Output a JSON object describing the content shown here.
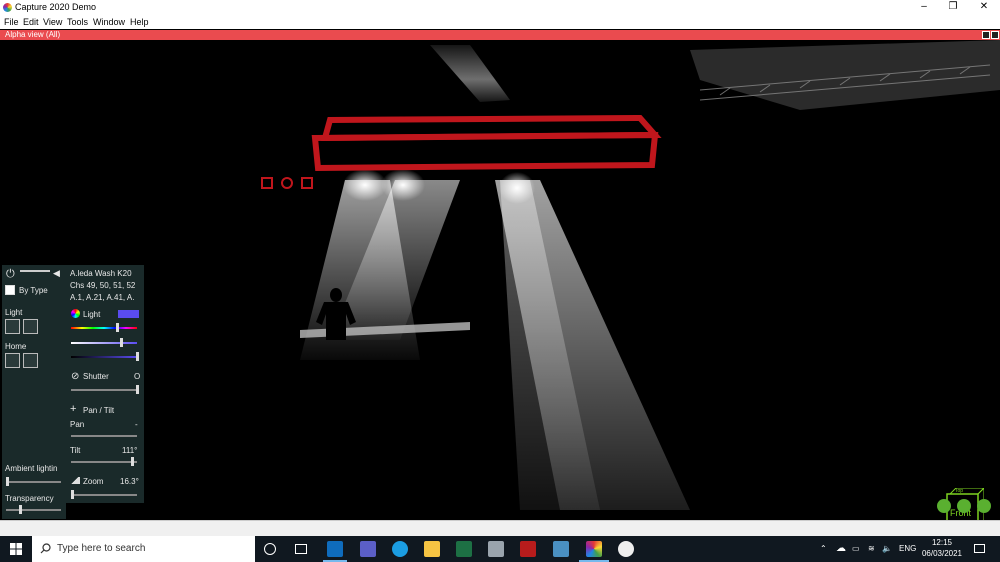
{
  "window": {
    "title": "Capture 2020 Demo",
    "controls": {
      "minimize": "–",
      "maximize": "❐",
      "close": "✕"
    }
  },
  "menu": [
    "File",
    "Edit",
    "View",
    "Tools",
    "Window",
    "Help"
  ],
  "view": {
    "title": "Alpha view  (All)"
  },
  "left_panel": {
    "by_type_label": "By Type",
    "light_label": "Light",
    "home_label": "Home",
    "ambient_label": "Ambient lightin",
    "transparency_label": "Transparency"
  },
  "fixture_panel": {
    "name": "A.leda Wash K20",
    "channels": "Chs 49, 50, 51, 52",
    "addresses": "A.1, A.21, A.41, A.",
    "light_label": "Light",
    "light_swatch_color": "#5a4cf0",
    "shutter_label": "Shutter",
    "shutter_value": "O",
    "pantilt_label": "Pan / Tilt",
    "pan_label": "Pan",
    "pan_value": "-",
    "tilt_label": "Tilt",
    "tilt_value": "111°",
    "zoom_label": "Zoom",
    "zoom_value": "16.3°"
  },
  "navcube": {
    "face_front": "Front",
    "face_top": "Top"
  },
  "taskbar": {
    "search_placeholder": "Type here to search",
    "language": "ENG",
    "time": "12:15",
    "date": "06/03/2021"
  },
  "colors": {
    "accent_red": "#ea4b4f",
    "selection_red": "#c0161c",
    "panel_bg": "#1a2a2a",
    "taskbar_bg": "#101820",
    "nav_green": "#5ab030"
  }
}
